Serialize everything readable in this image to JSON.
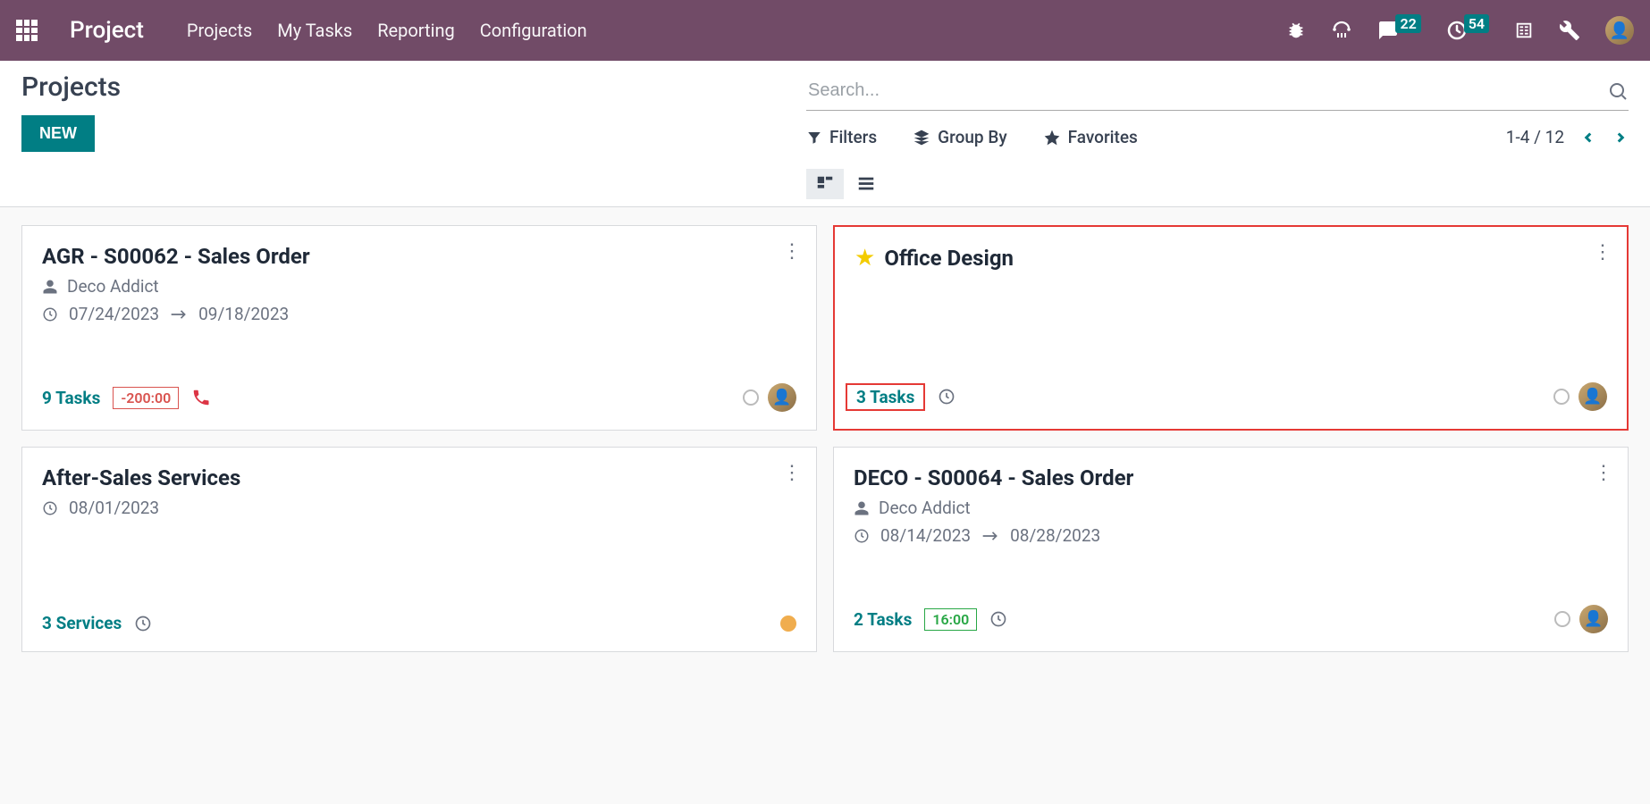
{
  "navbar": {
    "brand": "Project",
    "menu": [
      "Projects",
      "My Tasks",
      "Reporting",
      "Configuration"
    ],
    "badges": {
      "messages": "22",
      "activities": "54"
    }
  },
  "control": {
    "title": "Projects",
    "new_label": "NEW",
    "search_placeholder": "Search...",
    "filters_label": "Filters",
    "groupby_label": "Group By",
    "favorites_label": "Favorites",
    "pager": "1-4 / 12"
  },
  "cards": [
    {
      "title": "AGR - S00062 - Sales Order",
      "customer": "Deco Addict",
      "date_start": "07/24/2023",
      "date_end": "09/18/2023",
      "tasks": "9 Tasks",
      "time": "-200:00"
    },
    {
      "title": "Office Design",
      "tasks": "3 Tasks"
    },
    {
      "title": "After-Sales Services",
      "date_start": "08/01/2023",
      "tasks": "3 Services"
    },
    {
      "title": "DECO - S00064 - Sales Order",
      "customer": "Deco Addict",
      "date_start": "08/14/2023",
      "date_end": "08/28/2023",
      "tasks": "2 Tasks",
      "time": "16:00"
    }
  ]
}
